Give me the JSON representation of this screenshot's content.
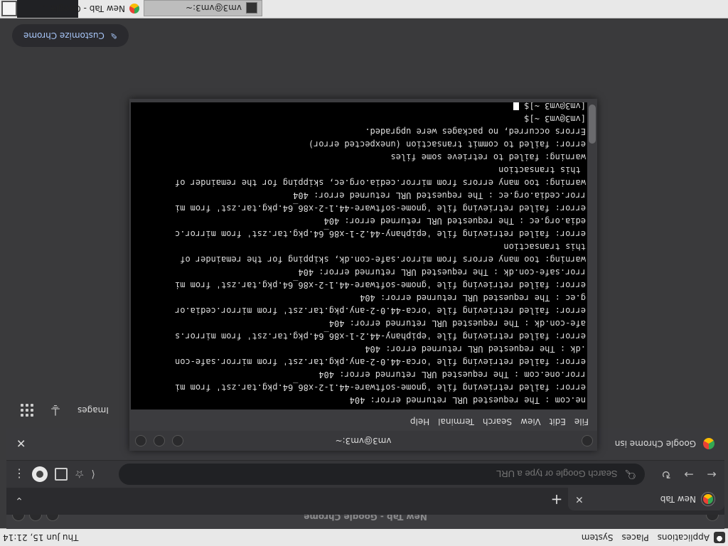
{
  "panel": {
    "menus": [
      "Applications",
      "Places",
      "System"
    ],
    "clock": "Thu Jun 15, 21:14"
  },
  "chrome": {
    "window_title": "New Tab - Google Chrome",
    "tab_label": "New Tab",
    "omnibox_placeholder": "Search Google or type a URL",
    "infobar_text": "Google Chrome isn",
    "ntp_links": {
      "images": "Images"
    },
    "customize_label": "Customize Chrome"
  },
  "terminal": {
    "title": "vm3@vm3:~",
    "menu": [
      "File",
      "Edit",
      "View",
      "Search",
      "Terminal",
      "Help"
    ],
    "lines": [
      "ne.com : The requested URL returned error: 404",
      "error: failed retrieving file 'gnome-software-44.1-2-x86_64.pkg.tar.zst' from mi",
      "rror.one.com : The requested URL returned error: 404",
      "error: failed retrieving file 'orca-44.0-2-any.pkg.tar.zst' from mirror.safe-con",
      ".dk : The requested URL returned error: 404",
      "error: failed retrieving file 'epiphany-44.2-1-x86_64.pkg.tar.zst' from mirror.s",
      "afe-con.dk : The requested URL returned error: 404",
      "error: failed retrieving file 'orca-44.0-2-any.pkg.tar.zst' from mirror.cedia.or",
      "g.ec : The requested URL returned error: 404",
      "error: failed retrieving file 'gnome-software-44.1-2-x86_64.pkg.tar.zst' from mi",
      "rror.safe-con.dk : The requested URL returned error: 404",
      "warning: too many errors from mirror.safe-con.dk, skipping for the remainder of",
      "this transaction",
      "error: failed retrieving file 'epiphany-44.2-1-x86_64.pkg.tar.zst' from mirror.c",
      "edia.org.ec : The requested URL returned error: 404",
      "error: failed retrieving file 'gnome-software-44.1-2-x86_64.pkg.tar.zst' from mi",
      "rror.cedia.org.ec : The requested URL returned error: 404",
      "warning: too many errors from mirror.cedia.org.ec, skipping for the remainder of",
      " this transaction",
      "warning: failed to retrieve some files",
      "error: failed to commit transaction (unexpected error)",
      "Errors occurred, no packages were upgraded.",
      "[vm3@vm3 ~]$",
      "[vm3@vm3 ~]$ "
    ]
  },
  "taskbar": {
    "chrome_task": "New Tab - Google ...",
    "terminal_task": "vm3@vm3:~"
  }
}
